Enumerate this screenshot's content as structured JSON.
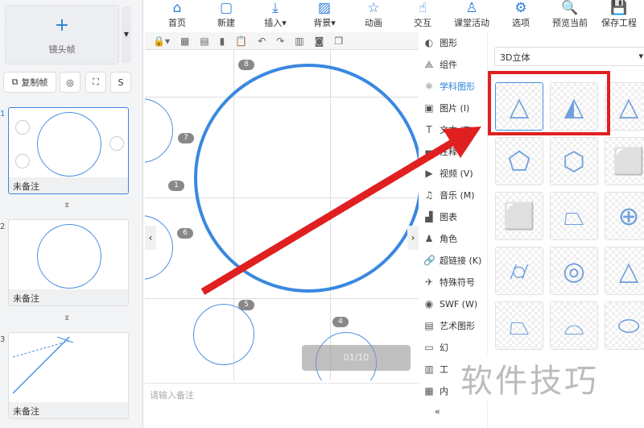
{
  "left_panel": {
    "lens_frame": "镜头帧",
    "copy_frame": "复制帧",
    "slides": [
      {
        "num": "1",
        "note": "未备注"
      },
      {
        "num": "2",
        "note": "未备注"
      },
      {
        "num": "3",
        "note": "未备注"
      }
    ]
  },
  "toolbar": [
    {
      "label": "首页",
      "icon": "⌂"
    },
    {
      "label": "新建",
      "icon": "▢"
    },
    {
      "label": "插入▾",
      "icon": "⤓"
    },
    {
      "label": "背景▾",
      "icon": "▨"
    },
    {
      "label": "动画",
      "icon": "☆"
    },
    {
      "label": "交互",
      "icon": "☝"
    },
    {
      "label": "课堂活动",
      "icon": "♙"
    },
    {
      "label": "选项",
      "icon": "⚙"
    },
    {
      "label": "预览当前",
      "icon": "🔍"
    },
    {
      "label": "保存工程",
      "icon": "💾"
    }
  ],
  "canvas": {
    "badges": [
      "8",
      "7",
      "1",
      "6",
      "5",
      "4"
    ],
    "pager": "01/10",
    "notes_placeholder": "请输入备注"
  },
  "menu": [
    {
      "label": "图形",
      "icon": "◐"
    },
    {
      "label": "组件",
      "icon": "⟁"
    },
    {
      "label": "学科图形",
      "icon": "⚛",
      "active": true
    },
    {
      "label": "图片 (I)",
      "icon": "▣"
    },
    {
      "label": "文本 (T)",
      "icon": "T"
    },
    {
      "label": "注释",
      "icon": "▬"
    },
    {
      "label": "视频 (V)",
      "icon": "▶"
    },
    {
      "label": "音乐 (M)",
      "icon": "♫"
    },
    {
      "label": "图表",
      "icon": "▟"
    },
    {
      "label": "角色",
      "icon": "♟"
    },
    {
      "label": "超链接 (K)",
      "icon": "🔗"
    },
    {
      "label": "特殊符号",
      "icon": "✈"
    },
    {
      "label": "SWF (W)",
      "icon": "◉"
    },
    {
      "label": "艺术图形",
      "icon": "▤"
    },
    {
      "label": "幻",
      "icon": "▭"
    },
    {
      "label": "工",
      "icon": "▥"
    },
    {
      "label": "内",
      "icon": "▦"
    }
  ],
  "collapse": "«",
  "shapes": {
    "category": "3D立体",
    "items": [
      "三棱锥",
      "三棱锥2",
      "四棱锥",
      "三棱柱",
      "三棱柱2",
      "正方体",
      "长方体",
      "棱台",
      "球体",
      "圆柱",
      "圆环柱",
      "圆锥",
      "圆台",
      "花瓶",
      "椭球"
    ]
  },
  "watermark": "软件技巧",
  "colors": {
    "accent": "#2d7fd8",
    "highlight": "#e02020"
  }
}
